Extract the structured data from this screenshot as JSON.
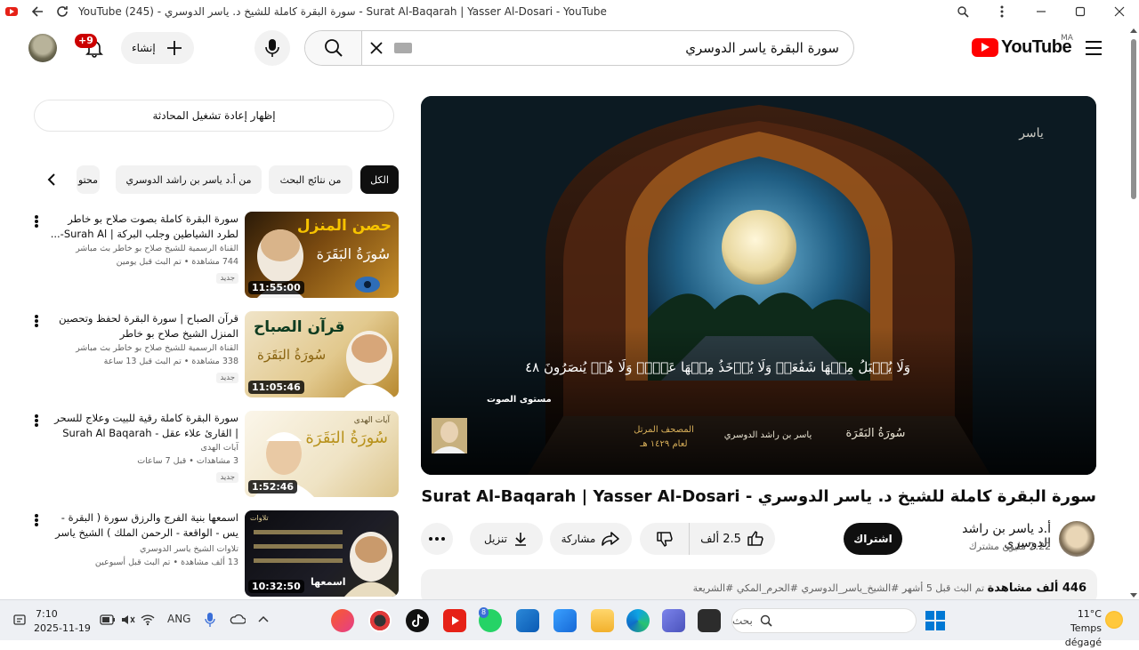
{
  "window": {
    "title": "YouTube (245) - سورة البقرة كاملة للشيخ د. ياسر الدوسري - Surat Al-Baqarah | Yasser Al-Dosari - YouTube"
  },
  "header": {
    "notif_count": "+9",
    "create_label": "إنشاء",
    "search_value": "سورة البقرة ياسر الدوسري",
    "logo_text": "YouTube",
    "country_code": "MA"
  },
  "sidebar": {
    "chat_replay": "إظهار إعادة تشغيل المحادثة",
    "chips": [
      "الكل",
      "من نتائج البحث",
      "من أ.د ياسر بن راشد الدوسري",
      "محتو"
    ],
    "recommendations": [
      {
        "title": "سورة البقرة كاملة بصوت صلاح بو خاطر لطرد الشياطين وجلب البركة | Surah Al-...",
        "channel": "القناة الرسمية للشيخ صلاح بو خاطر بث مباشر",
        "meta": "744 مشاهدة • تم البث قبل يومين",
        "badge": "جديد",
        "duration": "11:55:00",
        "thumb_text_1": "حصن المنزل",
        "thumb_text_2": "سُورَةُ البَقَرَة"
      },
      {
        "title": "قرآن الصباح | سورة البقرة لحفظ وتحصين المنزل الشيخ صلاح بو خاطر",
        "channel": "القناة الرسمية للشيخ صلاح بو خاطر بث مباشر",
        "meta": "338 مشاهدة • تم البث قبل 13 ساعة",
        "badge": "جديد",
        "duration": "11:05:46",
        "thumb_text_1": "قرآن الصباح",
        "thumb_text_2": "سُورَةُ البَقَرَة"
      },
      {
        "title": "سورة البقرة كاملة رقية للبيت وعلاج للسحر | القارئ علاء عقل - Surah Al Baqarah",
        "channel": "آيات الهدى",
        "meta": "3 مشاهدات • قبل 7 ساعات",
        "badge": "جديد",
        "duration": "1:52:46",
        "thumb_text_1": "آيات الهدى",
        "thumb_text_2": "سُورَةُ البَقَرَة"
      },
      {
        "title": "اسمعها بنية الفرج والرزق سورة ( البقرة - يس - الواقعة - الرحمن الملك ) الشيخ ياسر ...",
        "channel": "تلاوات الشيخ ياسر الدوسري",
        "meta": "13 ألف مشاهدة • تم البث قبل أسبوعين",
        "badge": "",
        "duration": "10:32:50",
        "thumb_text_1": "تلاوات",
        "thumb_text_2": "اسمعها"
      }
    ]
  },
  "player": {
    "verse_text": "وَلَا يُقۡبَلُ مِنۡهَا شَفَٰعَةٞ وَلَا يُؤۡخَذُ مِنۡهَا عَدۡلٞ وَلَا هُمۡ يُنصَرُونَ ٤٨",
    "volume_label": "مستوى الصوت",
    "surah_name": "سُورَةُ البَقَرَة",
    "reciter_name": "ياسر بن راشد الدوسري",
    "mushaf_label_1": "المصحف المرتل",
    "mushaf_label_2": "لعام ١٤٢٩ هـ"
  },
  "video": {
    "title": "سورة البقرة كاملة للشيخ د. ياسر الدوسري - Surat Al-Baqarah | Yasser Al-Dosari",
    "channel_name": "أ.د ياسر بن راشد الدوسري",
    "subscribers": "2.22 مليون مشترك",
    "subscribe_label": "اشتراك",
    "likes": "2.5 ألف",
    "share_label": "مشاركة",
    "download_label": "تنزيل",
    "views": "446 ألف مشاهدة",
    "date": "تم البث قبل 5 أشهر",
    "hashtags": "#الشيخ_ياسر_الدوسري #الحرم_المكي #الشريعة"
  },
  "taskbar": {
    "time": "7:10",
    "date": "2025-11-19",
    "lang": "ANG",
    "search_placeholder": "بحث",
    "weather_temp": "11°C",
    "weather_desc": "Temps dégagé",
    "whatsapp_badge": "8"
  }
}
